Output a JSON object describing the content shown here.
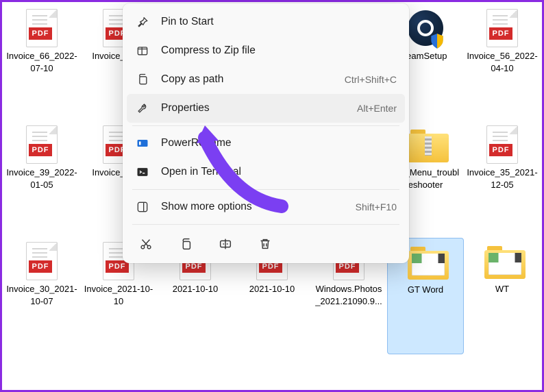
{
  "files": [
    {
      "type": "pdf",
      "name": "Invoice_66_2022-07-10"
    },
    {
      "type": "pdf",
      "name": "Invoice_2022"
    },
    {
      "type": "hidden",
      "name": ""
    },
    {
      "type": "hidden",
      "name": ""
    },
    {
      "type": "hidden",
      "name": ""
    },
    {
      "type": "exe",
      "name": "teamSetup"
    },
    {
      "type": "pdf",
      "name": "Invoice_56_2022-04-10"
    },
    {
      "type": "pdf",
      "name": "Invoice_39_2022-01-05"
    },
    {
      "type": "pdf",
      "name": "Invoice_2021"
    },
    {
      "type": "hidden",
      "name": ""
    },
    {
      "type": "hidden",
      "name": ""
    },
    {
      "type": "hidden",
      "name": ""
    },
    {
      "type": "zipfolder",
      "name": "tart_Menu_troubleshooter"
    },
    {
      "type": "pdf",
      "name": "Invoice_35_2021-12-05"
    },
    {
      "type": "pdf",
      "name": "Invoice_30_2021-10-07"
    },
    {
      "type": "pdf",
      "name": "Invoice_2021-10-10"
    },
    {
      "type": "pdf",
      "name": "2021-10-10"
    },
    {
      "type": "pdf",
      "name": "2021-10-10"
    },
    {
      "type": "pdf",
      "name": "Windows.Photos_2021.21090.9..."
    },
    {
      "type": "folder",
      "name": "GT Word",
      "selected": true
    },
    {
      "type": "folder",
      "name": "WT"
    }
  ],
  "pdf_badge": "PDF",
  "context_menu": {
    "items": [
      {
        "icon": "pin",
        "label": "Pin to Start",
        "shortcut": ""
      },
      {
        "icon": "zip",
        "label": "Compress to Zip file",
        "shortcut": ""
      },
      {
        "icon": "copy-path",
        "label": "Copy as path",
        "shortcut": "Ctrl+Shift+C"
      },
      {
        "icon": "properties",
        "label": "Properties",
        "shortcut": "Alt+Enter",
        "highlight": true
      }
    ],
    "items2": [
      {
        "icon": "powerrename",
        "label": "PowerRename",
        "shortcut": ""
      },
      {
        "icon": "terminal",
        "label": "Open in Terminal",
        "shortcut": ""
      }
    ],
    "items3": [
      {
        "icon": "more",
        "label": "Show more options",
        "shortcut": "Shift+F10"
      }
    ],
    "actions": [
      "cut",
      "copy",
      "rename",
      "delete"
    ]
  }
}
